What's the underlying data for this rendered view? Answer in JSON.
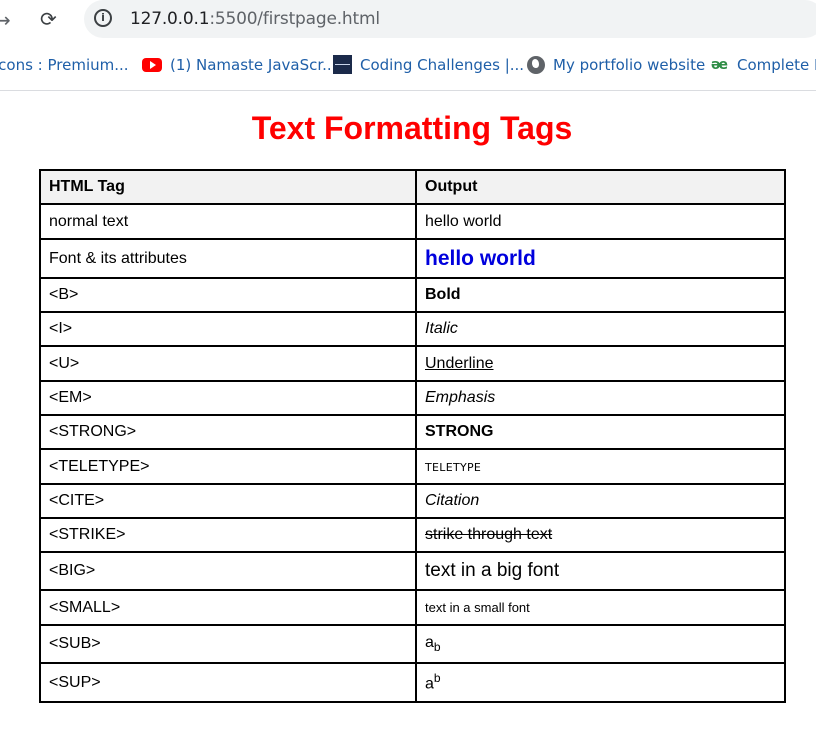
{
  "browser": {
    "url_host": "127.0.0.1",
    "url_path": ":5500/firstpage.html",
    "back_glyph": "→",
    "reload_glyph": "⟳",
    "info_glyph": "i"
  },
  "bookmarks": [
    {
      "label": "icons : Premium...",
      "icon": "none"
    },
    {
      "label": "(1) Namaste JavaScr...",
      "icon": "youtube-icon"
    },
    {
      "label": "Coding Challenges |...",
      "icon": "coding-challenges-icon"
    },
    {
      "label": "My portfolio website",
      "icon": "globe-icon"
    },
    {
      "label": "Complete R",
      "icon": "geeksforgeeks-icon",
      "glyph": "əе"
    }
  ],
  "page": {
    "title": "Text Formatting Tags",
    "title_color": "#ff0000",
    "table": {
      "headers": [
        "HTML Tag",
        "Output"
      ],
      "rows": [
        {
          "tag": "normal text",
          "output": "hello world"
        },
        {
          "tag": "Font & its attributes",
          "output": "hello world"
        },
        {
          "tag": "<B>",
          "output": "Bold"
        },
        {
          "tag": "<I>",
          "output": "Italic"
        },
        {
          "tag": "<U>",
          "output": "Underline"
        },
        {
          "tag": "<EM>",
          "output": "Emphasis"
        },
        {
          "tag": "<STRONG>",
          "output": "STRONG"
        },
        {
          "tag": "<TELETYPE>",
          "output": "teletype"
        },
        {
          "tag": "<CITE>",
          "output": "Citation"
        },
        {
          "tag": "<STRIKE>",
          "output": "strike through text"
        },
        {
          "tag": "<BIG>",
          "output": "text in a big font"
        },
        {
          "tag": "<SMALL>",
          "output": "text in a small font"
        },
        {
          "tag": "<SUB>",
          "output_base": "a",
          "output_script": "b"
        },
        {
          "tag": "<SUP>",
          "output_base": "a",
          "output_script": "b"
        }
      ]
    }
  }
}
